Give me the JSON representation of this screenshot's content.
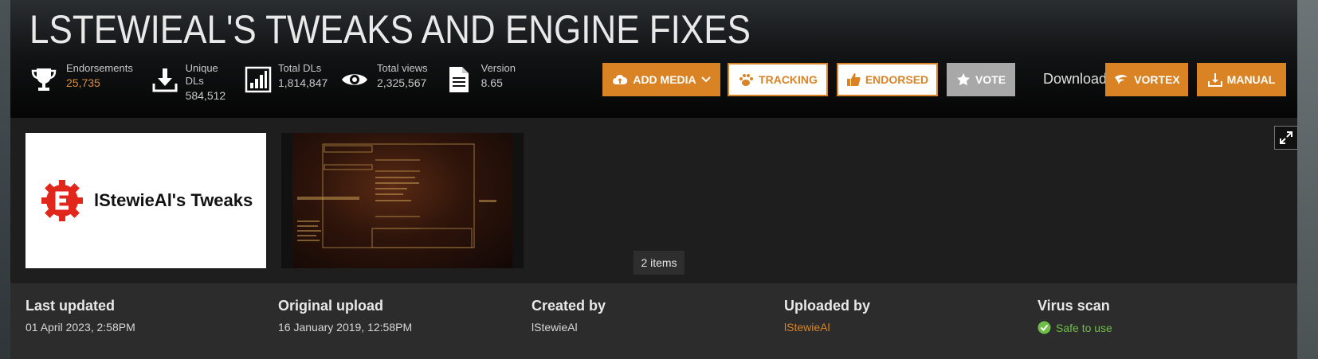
{
  "title": "LSTEWIEAL'S TWEAKS AND ENGINE FIXES",
  "stats": {
    "endorsements": {
      "label": "Endorsements",
      "value": "25,735",
      "icon": "trophy-icon"
    },
    "unique_dls": {
      "label": "Unique DLs",
      "value": "584,512",
      "icon": "download-icon"
    },
    "total_dls": {
      "label": "Total DLs",
      "value": "1,814,847",
      "icon": "bar-chart-icon"
    },
    "total_views": {
      "label": "Total views",
      "value": "2,325,567",
      "icon": "eye-icon"
    },
    "version": {
      "label": "Version",
      "value": "8.65",
      "icon": "document-icon"
    }
  },
  "actions": {
    "add_media": "ADD MEDIA",
    "tracking": "TRACKING",
    "endorsed": "ENDORSED",
    "vote": "VOTE",
    "download_label": "Download:",
    "vortex": "VORTEX",
    "manual": "MANUAL"
  },
  "gallery": {
    "thumb1_text": "lStewieAl's Tweaks",
    "items_count": "2 items"
  },
  "meta": {
    "last_updated": {
      "label": "Last updated",
      "value": "01 April 2023,  2:58PM"
    },
    "original_upload": {
      "label": "Original upload",
      "value": "16 January 2019,  12:58PM"
    },
    "created_by": {
      "label": "Created by",
      "value": "lStewieAl"
    },
    "uploaded_by": {
      "label": "Uploaded by",
      "value": "lStewieAl"
    },
    "virus_scan": {
      "label": "Virus scan",
      "value": "Safe to use"
    }
  },
  "colors": {
    "accent": "#d98324",
    "safe": "#6fbe47",
    "header_bg": "#121415"
  }
}
